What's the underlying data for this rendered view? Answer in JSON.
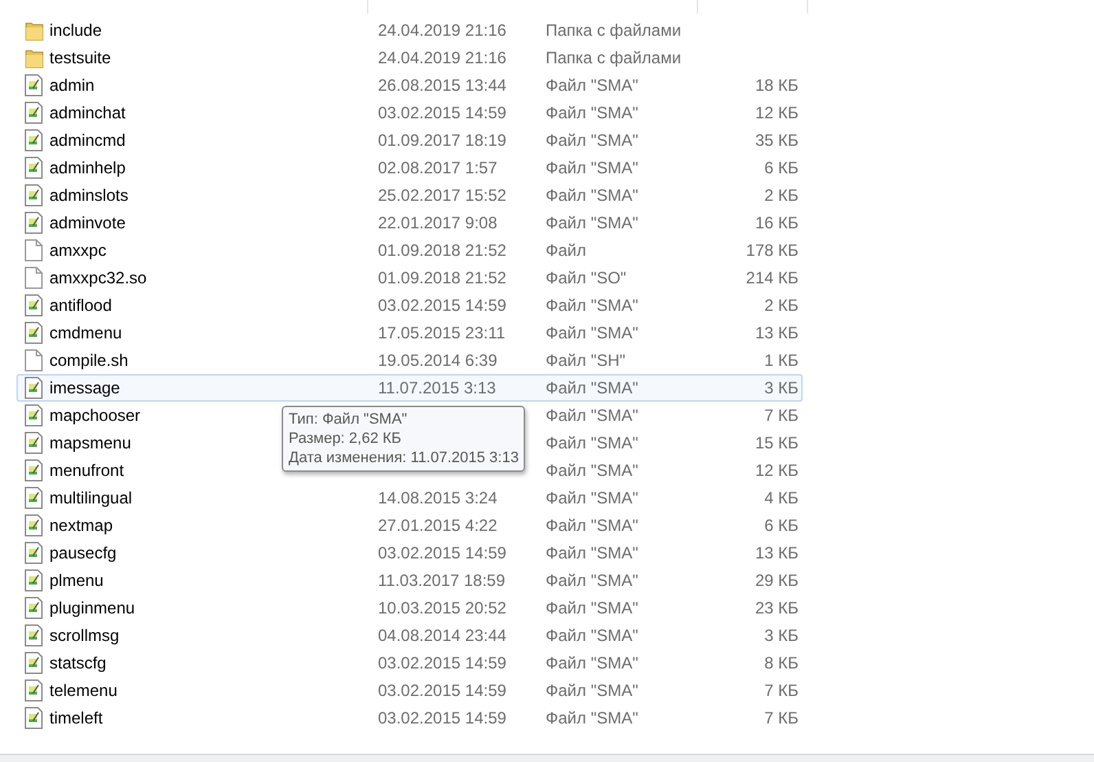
{
  "files": [
    {
      "name": "include",
      "kind": "folder",
      "date": "24.04.2019 21:16",
      "type": "Папка с файлами",
      "hovered": false
    },
    {
      "name": "testsuite",
      "kind": "folder",
      "date": "24.04.2019 21:16",
      "type": "Папка с файлами",
      "hovered": false
    },
    {
      "name": "admin",
      "kind": "sma",
      "date": "26.08.2015 13:44",
      "type": "Файл \"SMA\"",
      "size": "18 КБ",
      "hovered": false
    },
    {
      "name": "adminchat",
      "kind": "sma",
      "date": "03.02.2015 14:59",
      "type": "Файл \"SMA\"",
      "size": "12 КБ",
      "hovered": false
    },
    {
      "name": "admincmd",
      "kind": "sma",
      "date": "01.09.2017 18:19",
      "type": "Файл \"SMA\"",
      "size": "35 КБ",
      "hovered": false
    },
    {
      "name": "adminhelp",
      "kind": "sma",
      "date": "02.08.2017 1:57",
      "type": "Файл \"SMA\"",
      "size": "6 КБ",
      "hovered": false
    },
    {
      "name": "adminslots",
      "kind": "sma",
      "date": "25.02.2017 15:52",
      "type": "Файл \"SMA\"",
      "size": "2 КБ",
      "hovered": false
    },
    {
      "name": "adminvote",
      "kind": "sma",
      "date": "22.01.2017 9:08",
      "type": "Файл \"SMA\"",
      "size": "16 КБ",
      "hovered": false
    },
    {
      "name": "amxxpc",
      "kind": "file",
      "date": "01.09.2018 21:52",
      "type": "Файл",
      "size": "178 КБ",
      "hovered": false
    },
    {
      "name": "amxxpc32.so",
      "kind": "file",
      "date": "01.09.2018 21:52",
      "type": "Файл \"SO\"",
      "size": "214 КБ",
      "hovered": false
    },
    {
      "name": "antiflood",
      "kind": "sma",
      "date": "03.02.2015 14:59",
      "type": "Файл \"SMA\"",
      "size": "2 КБ",
      "hovered": false
    },
    {
      "name": "cmdmenu",
      "kind": "sma",
      "date": "17.05.2015 23:11",
      "type": "Файл \"SMA\"",
      "size": "13 КБ",
      "hovered": false
    },
    {
      "name": "compile.sh",
      "kind": "file",
      "date": "19.05.2014 6:39",
      "type": "Файл \"SH\"",
      "size": "1 КБ",
      "hovered": false
    },
    {
      "name": "imessage",
      "kind": "sma",
      "date": "11.07.2015 3:13",
      "type": "Файл \"SMA\"",
      "size": "3 КБ",
      "hovered": true
    },
    {
      "name": "mapchooser",
      "kind": "sma",
      "type": "Файл \"SMA\"",
      "size": "7 КБ",
      "hovered": false
    },
    {
      "name": "mapsmenu",
      "kind": "sma",
      "type": "Файл \"SMA\"",
      "size": "15 КБ",
      "hovered": false
    },
    {
      "name": "menufront",
      "kind": "sma",
      "type": "Файл \"SMA\"",
      "size": "12 КБ",
      "hovered": false
    },
    {
      "name": "multilingual",
      "kind": "sma",
      "date": "14.08.2015 3:24",
      "type": "Файл \"SMA\"",
      "size": "4 КБ",
      "hovered": false
    },
    {
      "name": "nextmap",
      "kind": "sma",
      "date": "27.01.2015 4:22",
      "type": "Файл \"SMA\"",
      "size": "6 КБ",
      "hovered": false
    },
    {
      "name": "pausecfg",
      "kind": "sma",
      "date": "03.02.2015 14:59",
      "type": "Файл \"SMA\"",
      "size": "13 КБ",
      "hovered": false
    },
    {
      "name": "plmenu",
      "kind": "sma",
      "date": "11.03.2017 18:59",
      "type": "Файл \"SMA\"",
      "size": "29 КБ",
      "hovered": false
    },
    {
      "name": "pluginmenu",
      "kind": "sma",
      "date": "10.03.2015 20:52",
      "type": "Файл \"SMA\"",
      "size": "23 КБ",
      "hovered": false
    },
    {
      "name": "scrollmsg",
      "kind": "sma",
      "date": "04.08.2014 23:44",
      "type": "Файл \"SMA\"",
      "size": "3 КБ",
      "hovered": false
    },
    {
      "name": "statscfg",
      "kind": "sma",
      "date": "03.02.2015 14:59",
      "type": "Файл \"SMA\"",
      "size": "8 КБ",
      "hovered": false
    },
    {
      "name": "telemenu",
      "kind": "sma",
      "date": "03.02.2015 14:59",
      "type": "Файл \"SMA\"",
      "size": "7 КБ",
      "hovered": false
    },
    {
      "name": "timeleft",
      "kind": "sma",
      "date": "03.02.2015 14:59",
      "type": "Файл \"SMA\"",
      "size": "7 КБ",
      "hovered": false
    }
  ],
  "tooltip": {
    "lines": [
      "Тип: Файл \"SMA\"",
      "Размер: 2,62 КБ",
      "Дата изменения: 11.07.2015 3:13"
    ]
  }
}
